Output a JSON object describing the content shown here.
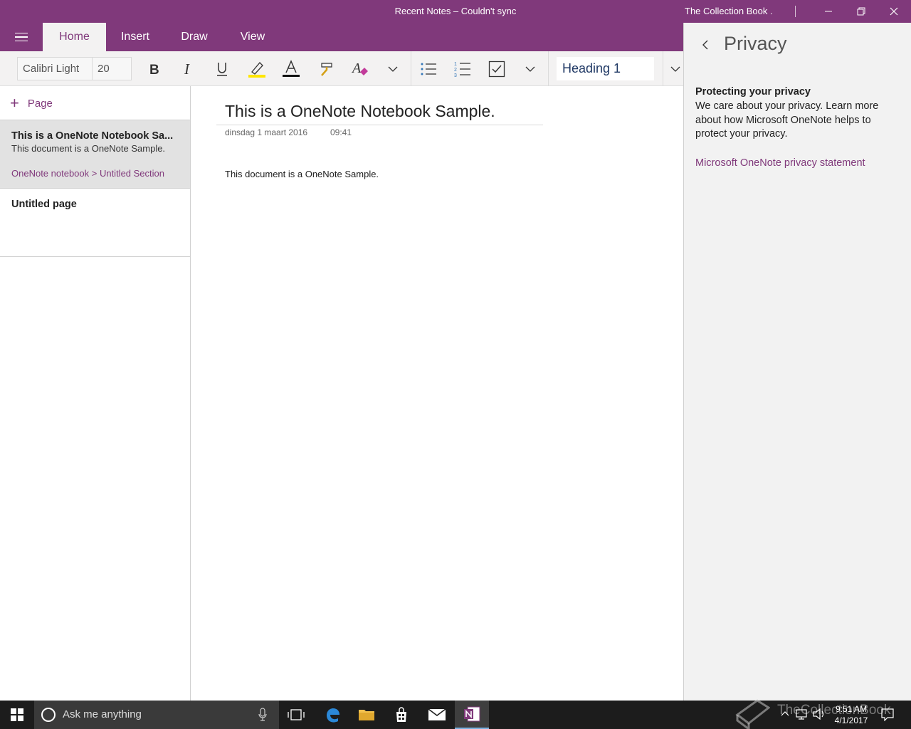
{
  "window": {
    "title": "Recent Notes – Couldn't sync",
    "account": "The Collection Book ."
  },
  "ribbon": {
    "tabs": [
      {
        "label": "Home",
        "active": true
      },
      {
        "label": "Insert",
        "active": false
      },
      {
        "label": "Draw",
        "active": false
      },
      {
        "label": "View",
        "active": false
      }
    ],
    "font_name": "Calibri Light",
    "font_size": "20",
    "style": "Heading 1"
  },
  "pagelist": {
    "add_page_label": "Page",
    "pages": [
      {
        "title": "This is a OneNote Notebook Sa...",
        "preview": "This document is a OneNote Sample.",
        "path": "OneNote notebook  >  Untitled Section",
        "selected": true
      },
      {
        "title": "Untitled page",
        "selected": false
      }
    ]
  },
  "note": {
    "title": "This is a OneNote Notebook Sample.",
    "date": "dinsdag 1 maart 2016",
    "time": "09:41",
    "body": "This document is a OneNote Sample."
  },
  "privacy_pane": {
    "title": "Privacy",
    "heading": "Protecting your privacy",
    "body": "We care about your privacy. Learn more about how Microsoft OneNote helps to protect your privacy.",
    "link": "Microsoft OneNote privacy statement"
  },
  "taskbar": {
    "search_placeholder": "Ask me anything",
    "time": "9:51 AM",
    "date": "4/1/2017",
    "watermark": "TheCollectionBook"
  },
  "colors": {
    "brand": "#80397b",
    "taskbar": "#1c1c1c"
  }
}
